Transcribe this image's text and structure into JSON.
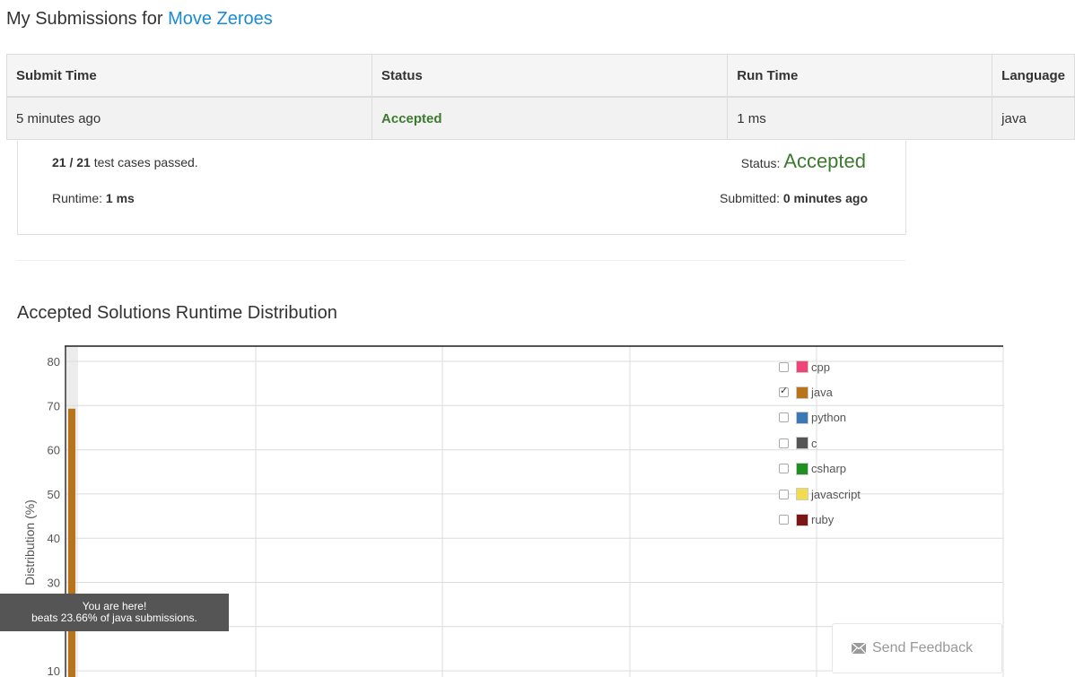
{
  "header": {
    "prefix": "My Submissions for ",
    "problem_link": "Move Zeroes"
  },
  "table": {
    "headers": [
      "Submit Time",
      "Status",
      "Run Time",
      "Language"
    ],
    "rows": [
      {
        "submit_time": "5 minutes ago",
        "status": "Accepted",
        "run_time": "1 ms",
        "language": "java"
      }
    ]
  },
  "detail": {
    "cases_passed": "21 / 21",
    "cases_text": " test cases passed.",
    "runtime_label": "Runtime: ",
    "runtime_value": "1 ms",
    "status_label": "Status: ",
    "status_value": "Accepted",
    "submitted_label": "Submitted: ",
    "submitted_value": "0 minutes ago"
  },
  "chart_title": "Accepted Solutions Runtime Distribution",
  "chart_data": {
    "type": "bar",
    "title": "Accepted Solutions Runtime Distribution",
    "ylabel": "Distribution (%)",
    "xlabel": "",
    "ylim": [
      0,
      82
    ],
    "yticks": [
      10,
      20,
      30,
      40,
      50,
      60,
      70,
      80
    ],
    "grid": true,
    "series": [
      {
        "name": "java",
        "color": "#b8741a",
        "bars": [
          {
            "x": 1,
            "value": 69.3
          }
        ]
      }
    ]
  },
  "legend": [
    {
      "label": "cpp",
      "color": "#f0437a",
      "checked": false
    },
    {
      "label": "java",
      "color": "#b8741a",
      "checked": true
    },
    {
      "label": "python",
      "color": "#3c78b4",
      "checked": false
    },
    {
      "label": "c",
      "color": "#555555",
      "checked": false
    },
    {
      "label": "csharp",
      "color": "#1f8f1f",
      "checked": false
    },
    {
      "label": "javascript",
      "color": "#f0dc4e",
      "checked": false
    },
    {
      "label": "ruby",
      "color": "#7a1616",
      "checked": false
    }
  ],
  "tooltip": {
    "line1": "You are here!",
    "line2": "beats 23.66% of java submissions."
  },
  "feedback": {
    "label": "Send Feedback",
    "icon": "envelope-icon"
  }
}
